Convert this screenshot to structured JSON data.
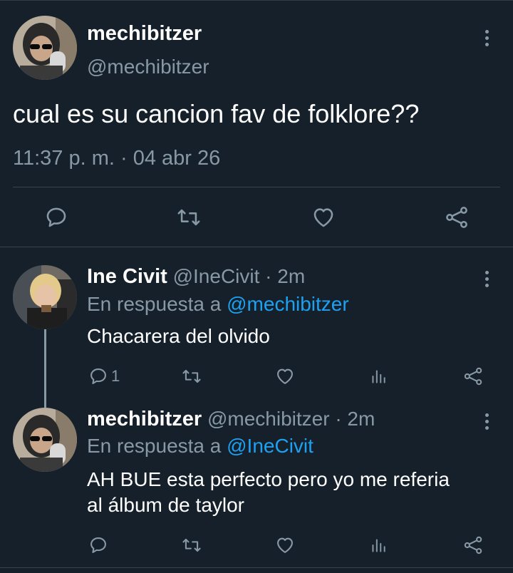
{
  "main_tweet": {
    "display_name": "mechibitzer",
    "handle": "@mechibitzer",
    "text": "cual es su cancion fav de folklore??",
    "timestamp": "11:37 p. m. · 04 abr 26",
    "actions": [
      "reply-icon",
      "retweet-icon",
      "like-icon",
      "share-icon"
    ]
  },
  "replies": [
    {
      "display_name": "Ine Civit",
      "handle": "@IneCivit",
      "time": "· 2m",
      "reply_prefix": "En respuesta a",
      "reply_to": "@mechibitzer",
      "text": "Chacarera del olvido",
      "reply_count": "1",
      "actions": [
        "reply-icon",
        "retweet-icon",
        "like-icon",
        "analytics-icon",
        "share-icon"
      ]
    },
    {
      "display_name": "mechibitzer",
      "handle": "@mechibitzer",
      "time": "· 2m",
      "reply_prefix": "En respuesta a",
      "reply_to": "@IneCivit",
      "text_line1": "AH BUE esta perfecto pero yo me referia",
      "text_line2": "al álbum de taylor",
      "actions": [
        "reply-icon",
        "retweet-icon",
        "like-icon",
        "analytics-icon",
        "share-icon"
      ]
    }
  ],
  "colors": {
    "background": "#15202b",
    "muted": "#8899a6",
    "link": "#1da1f2",
    "divider": "#38444d",
    "thread_line": "#8899a6"
  }
}
